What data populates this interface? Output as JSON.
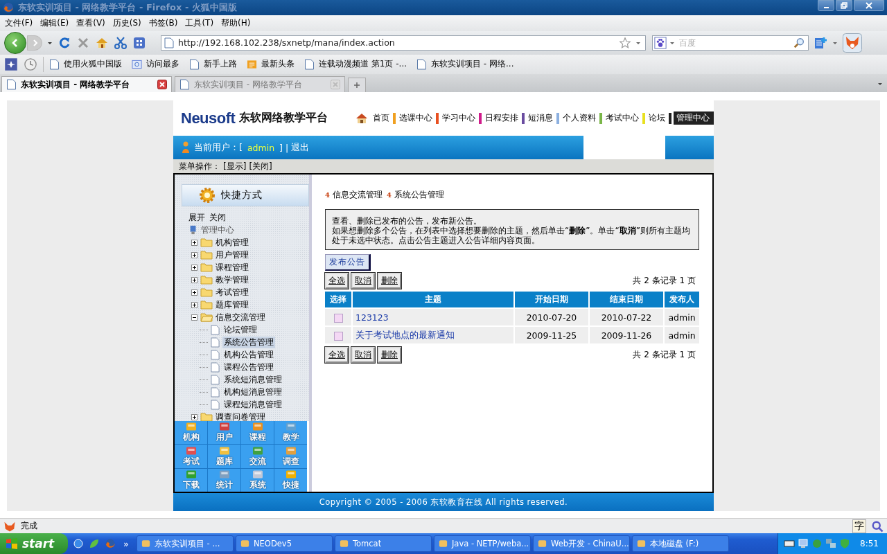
{
  "window": {
    "title": "东软实训项目 - 网络教学平台 - Firefox - 火狐中国版"
  },
  "menu": [
    "文件(F)",
    "编辑(E)",
    "查看(V)",
    "历史(S)",
    "书签(B)",
    "工具(T)",
    "帮助(H)"
  ],
  "toolbar": {
    "url": "http://192.168.102.238/sxnetp/mana/index.action",
    "search_placeholder": "百度"
  },
  "bookmarks": [
    {
      "label": "使用火狐中国版",
      "kind": "page"
    },
    {
      "label": "访问最多",
      "kind": "folder"
    },
    {
      "label": "新手上路",
      "kind": "page"
    },
    {
      "label": "最新头条",
      "kind": "feed"
    },
    {
      "label": "连载动漫频道 第1页 -...",
      "kind": "page"
    },
    {
      "label": "东软实训项目 - 网络...",
      "kind": "page"
    }
  ],
  "tabs": [
    {
      "label": "东软实训项目 - 网络教学平台",
      "selected": true
    },
    {
      "label": "东软实训项目 - 网络教学平台",
      "selected": false
    }
  ],
  "site": {
    "logo": "Neusoft",
    "title": "东软网络教学平台",
    "nav": [
      {
        "label": "首页",
        "selected": false
      },
      {
        "label": "选课中心",
        "color": "#f0a020",
        "selected": false
      },
      {
        "label": "学习中心",
        "color": "#e85020",
        "selected": false
      },
      {
        "label": "日程安排",
        "color": "#d01c8b",
        "selected": false
      },
      {
        "label": "短消息",
        "color": "#6a4ca0",
        "selected": false
      },
      {
        "label": "个人资料",
        "color": "#8cb0e0",
        "selected": false
      },
      {
        "label": "考试中心",
        "color": "#7ab648",
        "selected": false
      },
      {
        "label": "论坛",
        "color": "#e8e020",
        "selected": false
      },
      {
        "label": "管理中心",
        "color": "#222222",
        "selected": true
      }
    ],
    "user_bar": {
      "prefix": "当前用户：[",
      "user": "admin",
      "suffix": "]",
      "separator": "|",
      "logout": "退出"
    },
    "menu_ops": {
      "label": "菜单操作：",
      "links": [
        "[显示]",
        "[关闭]"
      ]
    },
    "footer": "Copyright © 2005 - 2006 东软教育在线 All rights reserved."
  },
  "sidebar": {
    "header": "快捷方式",
    "controls": [
      "展开",
      "关闭"
    ],
    "root": "管理中心",
    "tree": [
      {
        "label": "机构管理",
        "expanded": false
      },
      {
        "label": "用户管理",
        "expanded": false
      },
      {
        "label": "课程管理",
        "expanded": false
      },
      {
        "label": "教学管理",
        "expanded": false
      },
      {
        "label": "考试管理",
        "expanded": false
      },
      {
        "label": "题库管理",
        "expanded": false
      },
      {
        "label": "信息交流管理",
        "expanded": true,
        "children": [
          {
            "label": "论坛管理",
            "selected": false
          },
          {
            "label": "系统公告管理",
            "selected": true
          },
          {
            "label": "机构公告管理",
            "selected": false
          },
          {
            "label": "课程公告管理",
            "selected": false
          },
          {
            "label": "系统短消息管理",
            "selected": false
          },
          {
            "label": "机构短消息管理",
            "selected": false
          },
          {
            "label": "课程短消息管理",
            "selected": false
          }
        ]
      },
      {
        "label": "调查问卷管理",
        "expanded": false
      }
    ],
    "shortcuts": [
      "机构",
      "用户",
      "课程",
      "教学",
      "考试",
      "题库",
      "交流",
      "调查",
      "下载",
      "统计",
      "系统",
      "快捷"
    ]
  },
  "content": {
    "breadcrumb": [
      {
        "marker": "4",
        "label": "信息交流管理"
      },
      {
        "marker": "4",
        "label": "系统公告管理"
      }
    ],
    "info": [
      "查看、删除已发布的公告，发布新公告。",
      "如果想删除多个公告，在列表中选择想要删除的主题，然后单击“**删除**”。单击“**取消**”则所有主题均处于未选中状态。点击公告主题进入公告详细内容页面。"
    ],
    "publish_button": "发布公告",
    "top_actions": {
      "buttons": [
        "全选",
        "取消",
        "删除"
      ],
      "summary": "共 2 条记录 1 页"
    },
    "table": {
      "columns": [
        "选择",
        "主题",
        "开始日期",
        "结束日期",
        "发布人"
      ],
      "rows": [
        {
          "checked": false,
          "subject": "123123",
          "start": "2010-07-20",
          "end": "2010-07-22",
          "author": "admin"
        },
        {
          "checked": false,
          "subject": "关于考试地点的最新通知",
          "start": "2009-11-25",
          "end": "2009-11-26",
          "author": "admin"
        }
      ]
    },
    "bottom_actions": {
      "buttons": [
        "全选",
        "取消",
        "删除"
      ],
      "summary": "共 2 条记录 1 页"
    }
  },
  "status_bar": {
    "text": "完成",
    "ime": "字"
  },
  "taskbar": {
    "start": "start",
    "items": [
      "东软实训项目 - ...",
      "NEODev5",
      "Tomcat",
      "Java - NETP/weba...",
      "Web开发 - ChinaU...",
      "本地磁盘 (F:)"
    ],
    "more": "»",
    "clock": "8:51"
  }
}
